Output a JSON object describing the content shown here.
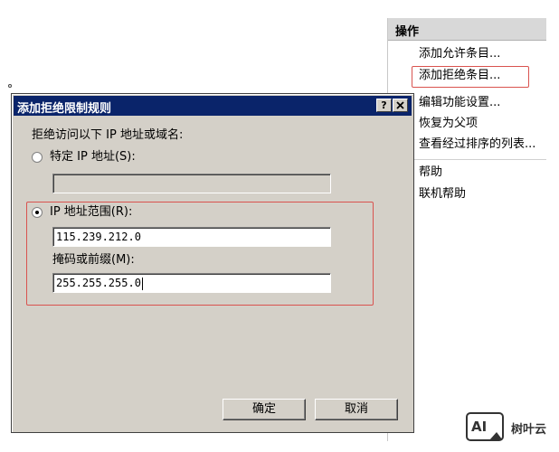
{
  "actions_panel": {
    "header": "操作",
    "items": [
      {
        "label": "添加允许条目..."
      },
      {
        "label": "添加拒绝条目..."
      },
      {
        "label": "编辑功能设置..."
      },
      {
        "label": "恢复为父项"
      },
      {
        "label": "查看经过排序的列表..."
      },
      {
        "label": "帮助"
      },
      {
        "label": "联机帮助"
      }
    ]
  },
  "dialog": {
    "title": "添加拒绝限制规则",
    "help_button": "?",
    "close_button": "×",
    "prompt": "拒绝访问以下 IP 地址或域名:",
    "specific_ip": {
      "label": "特定 IP 地址(S):",
      "selected": false,
      "value": ""
    },
    "ip_range": {
      "label": "IP 地址范围(R):",
      "selected": true,
      "value": "115.239.212.0"
    },
    "mask": {
      "label": "掩码或前缀(M):",
      "value": "255.255.255.0"
    },
    "ok_label": "确定",
    "cancel_label": "取消"
  },
  "watermark": {
    "logo_text": "AI",
    "name": "树叶云"
  },
  "colors": {
    "title_bar": "#0a246a",
    "dialog_bg": "#d4d0c8",
    "highlight_red": "#d9534f"
  }
}
